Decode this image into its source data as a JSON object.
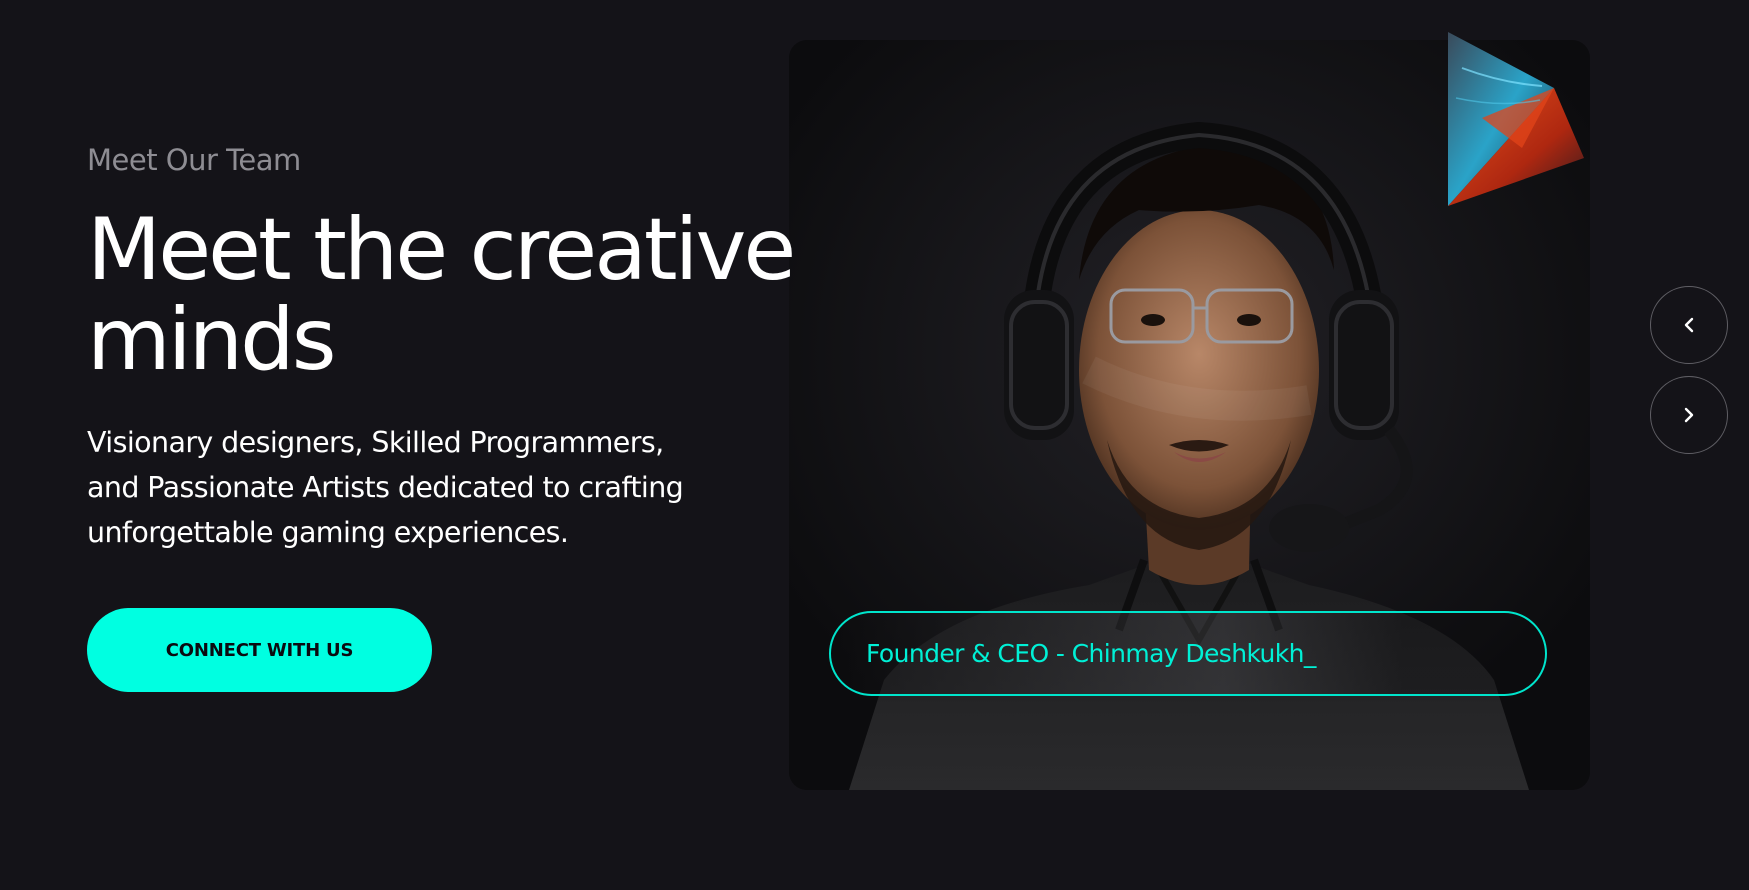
{
  "section": {
    "eyebrow": "Meet Our Team",
    "headline_line1": "Meet the creative",
    "headline_line2": "minds",
    "subtitle_line1": "Visionary designers, Skilled Programmers,",
    "subtitle_line2": "and Passionate Artists dedicated to crafting",
    "subtitle_line3": "unforgettable gaming experiences.",
    "cta_label": "CONNECT WITH US"
  },
  "slide": {
    "role_label": "Founder & CEO - Chinmay Deshkukh_"
  },
  "nav": {
    "prev_icon": "chevron-left-icon",
    "next_icon": "chevron-right-icon"
  },
  "colors": {
    "background": "#141318",
    "accent": "#00ffe1",
    "text": "#ffffff",
    "muted": "#8e8d93"
  }
}
